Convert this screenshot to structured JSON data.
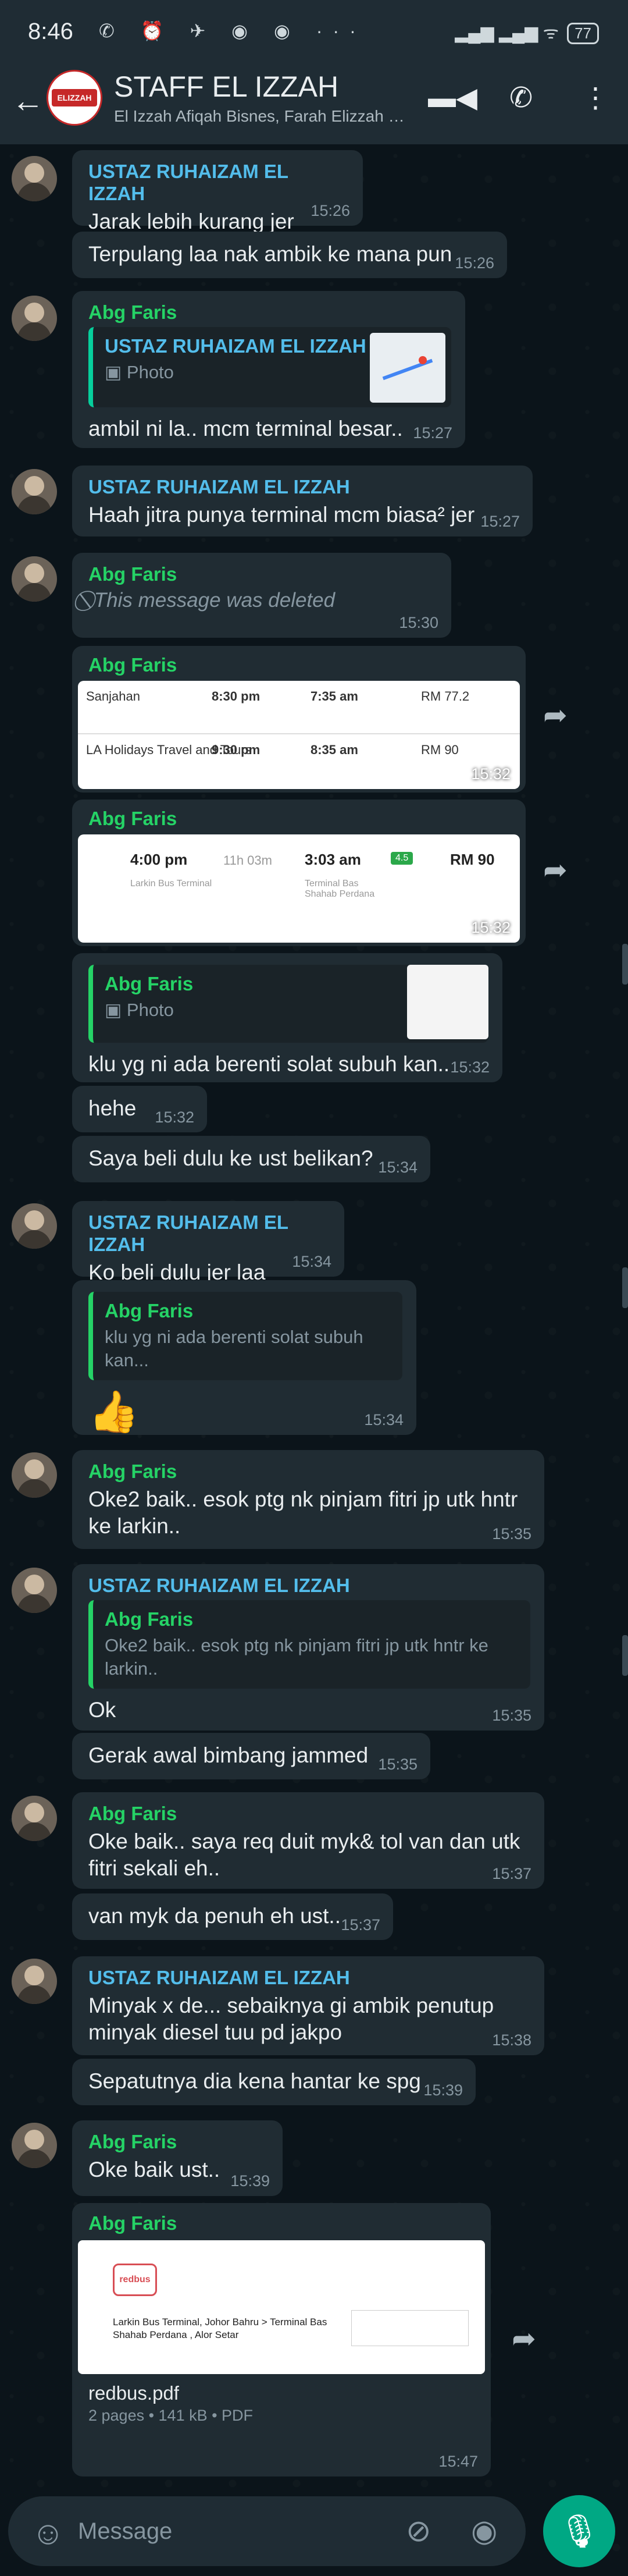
{
  "status": {
    "time": "8:46",
    "icons": "✆ ⏰ ✈ ◉ ◉ ···",
    "right": "▂▄▆ ▂▄▆ ᯤ",
    "battery": "77"
  },
  "header": {
    "title": "STAFF EL IZZAH",
    "subtitle": "El Izzah Afiqah Bisnes, Farah Elizzah H...",
    "logo_text": "ELIZZAH"
  },
  "messages": [
    {
      "sender": "USTAZ RUHAIZAM EL IZZAH",
      "text": "Jarak lebih kurang jer",
      "time": "15:26"
    },
    {
      "text": "Terpulang laa nak ambik ke mana pun",
      "time": "15:26"
    },
    {
      "sender": "Abg Faris",
      "quote_sender": "USTAZ RUHAIZAM EL IZZAH",
      "quote_text": "▣ Photo",
      "text": "ambil ni la.. mcm terminal besar..",
      "time": "15:27"
    },
    {
      "sender": "USTAZ RUHAIZAM EL IZZAH",
      "text": "Haah jitra punya terminal mcm biasa² jer",
      "time": "15:27"
    },
    {
      "sender": "Abg Faris",
      "text": "This message was deleted",
      "time": "15:30"
    },
    {
      "sender": "Abg Faris",
      "time": "15:32",
      "row1": [
        "Sanjahan",
        "8:30 pm",
        "7:35 am",
        "RM 77.2"
      ],
      "row2": [
        "LA Holidays Travel and Tours",
        "9:30 pm",
        "8:35 am",
        "RM 90"
      ]
    },
    {
      "sender": "Abg Faris",
      "time": "15:32",
      "depart": "4:00 pm",
      "duration": "11h 03m",
      "arrive": "3:03 am",
      "rating": "4.5",
      "price": "RM 90",
      "from": "Larkin Bus Terminal",
      "to": "Terminal Bas Shahab Perdana"
    },
    {
      "quote_sender": "Abg Faris",
      "quote_text": "▣ Photo",
      "text": "klu yg ni ada berenti solat subuh kan..",
      "time": "15:32"
    },
    {
      "text": "hehe",
      "time": "15:32"
    },
    {
      "text": "Saya beli dulu ke ust belikan?",
      "time": "15:34"
    },
    {
      "sender": "USTAZ RUHAIZAM EL IZZAH",
      "text": "Ko beli dulu jer laa",
      "time": "15:34"
    },
    {
      "quote_sender": "Abg Faris",
      "quote_text": "klu yg ni ada berenti solat subuh kan...",
      "text": "👍",
      "time": "15:34"
    },
    {
      "sender": "Abg Faris",
      "text": "Oke2 baik.. esok ptg nk pinjam fitri jp utk hntr ke larkin..",
      "time": "15:35"
    },
    {
      "sender": "USTAZ RUHAIZAM EL IZZAH",
      "quote_sender": "Abg Faris",
      "quote_text": "Oke2 baik.. esok ptg nk pinjam fitri jp utk hntr ke larkin..",
      "text": "Ok",
      "time": "15:35"
    },
    {
      "text": "Gerak awal bimbang jammed",
      "time": "15:35"
    },
    {
      "sender": "Abg Faris",
      "text": "Oke baik.. saya req duit myk& tol van dan utk fitri sekali eh..",
      "time": "15:37"
    },
    {
      "text": "van myk da penuh eh ust..",
      "time": "15:37"
    },
    {
      "sender": "USTAZ RUHAIZAM EL IZZAH",
      "text": "Minyak x de... sebaiknya gi ambik penutup minyak diesel tuu pd jakpo",
      "time": "15:38"
    },
    {
      "text": "Sepatutnya dia kena hantar ke spg",
      "time": "15:39"
    },
    {
      "sender": "Abg Faris",
      "text": "Oke baik ust..",
      "time": "15:39"
    },
    {
      "sender": "Abg Faris",
      "pdf_name": "redbus.pdf",
      "pdf_meta": "2 pages • 141 kB • PDF",
      "time": "15:47",
      "pdf_brand": "redbus",
      "pdf_route": "Larkin Bus Terminal, Johor Bahru  >  Terminal Bas Shahab Perdana , Alor Setar"
    }
  ],
  "input": {
    "placeholder": "Message"
  }
}
